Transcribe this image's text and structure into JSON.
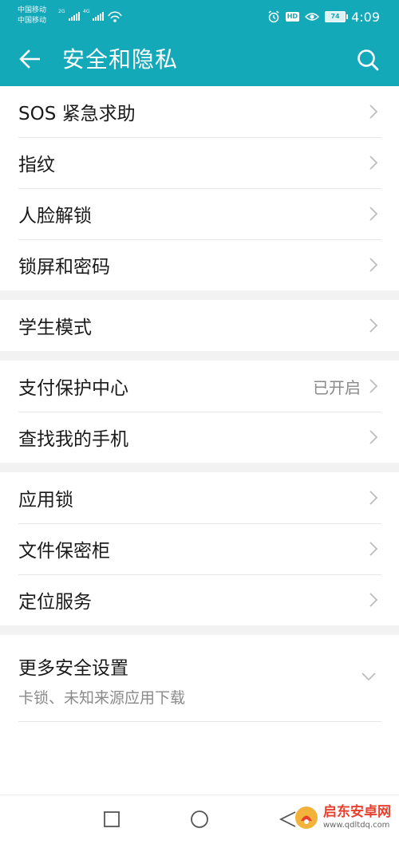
{
  "status_bar": {
    "carrier_1": "中国移动",
    "carrier_2": "中国移动",
    "net_1": "2G",
    "net_2": "4G",
    "hd_badge": "HD",
    "battery": "74",
    "time": "4:09",
    "icons": [
      "signal-icon",
      "wifi-icon",
      "alarm-icon",
      "eye-icon",
      "battery-icon"
    ]
  },
  "header": {
    "title": "安全和隐私",
    "back_icon": "arrow-left-icon",
    "search_icon": "search-icon",
    "background": "#14a9b9"
  },
  "groups": [
    {
      "items": [
        {
          "label": "SOS 紧急求助"
        },
        {
          "label": "指纹"
        },
        {
          "label": "人脸解锁"
        },
        {
          "label": "锁屏和密码"
        }
      ]
    },
    {
      "items": [
        {
          "label": "学生模式"
        }
      ]
    },
    {
      "items": [
        {
          "label": "支付保护中心",
          "value": "已开启"
        },
        {
          "label": "查找我的手机"
        }
      ]
    },
    {
      "items": [
        {
          "label": "应用锁"
        },
        {
          "label": "文件保密柜"
        },
        {
          "label": "定位服务"
        }
      ]
    }
  ],
  "more": {
    "label": "更多安全设置",
    "subtitle": "卡锁、未知来源应用下载"
  },
  "navbar": {
    "icons": [
      "recent-apps-icon",
      "home-icon",
      "back-triangle-icon"
    ]
  },
  "watermark": {
    "name": "启东安卓网",
    "url": "www.qdltdq.com"
  }
}
